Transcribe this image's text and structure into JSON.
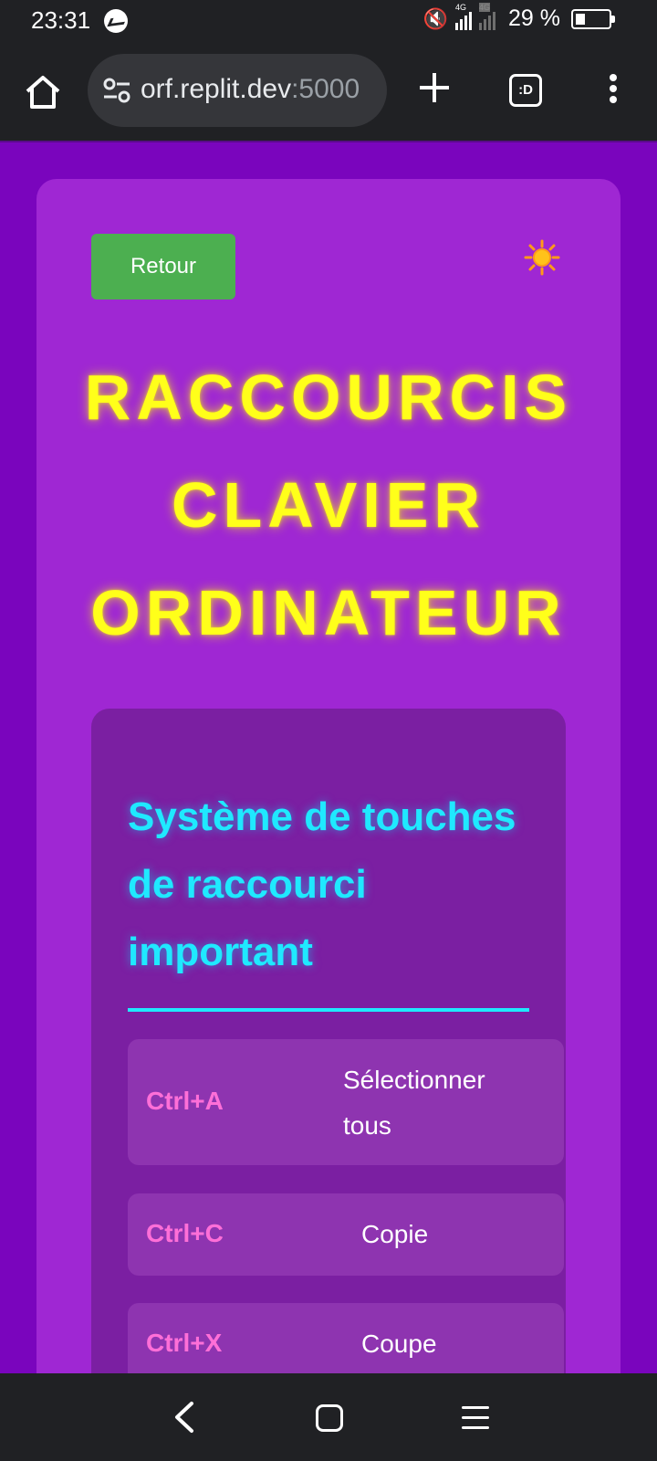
{
  "status": {
    "time": "23:31",
    "network_1": "4G",
    "network_2": "4G",
    "battery": "29 %",
    "battery_level": 0.29,
    "icons": [
      "messenger-icon",
      "mute-icon",
      "signal-icon",
      "battery-icon"
    ]
  },
  "browser": {
    "url_host": "orf.replit.dev",
    "url_port": ":5000",
    "tabs_label": ":D"
  },
  "page": {
    "back_label": "Retour",
    "theme_icon": "sun-icon",
    "title_lines": [
      "RACCOURCIS",
      "CLAVIER",
      "ORDINATEUR"
    ],
    "section": {
      "title": "Système de touches de raccourci important",
      "shortcuts": [
        {
          "key": "Ctrl+A",
          "desc": "Sélectionner tous"
        },
        {
          "key": "Ctrl+C",
          "desc": "Copie"
        },
        {
          "key": "Ctrl+X",
          "desc": "Coupe"
        }
      ]
    },
    "colors": {
      "page_bg": "#7a05bd",
      "card_bg": "#9f27d3",
      "title": "#ffff1a",
      "section_title": "#1fe9ff",
      "key": "#ff6fd8",
      "back_button": "#4caf50"
    }
  }
}
